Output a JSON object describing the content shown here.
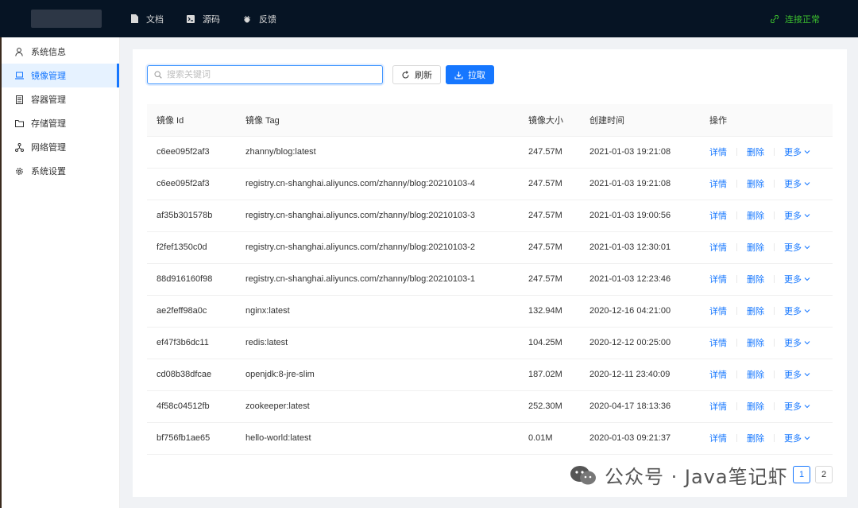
{
  "topbar": {
    "nav": [
      {
        "label": "文档",
        "icon": "document-icon"
      },
      {
        "label": "源码",
        "icon": "code-icon"
      },
      {
        "label": "反馈",
        "icon": "bug-icon"
      }
    ],
    "status": "连接正常"
  },
  "sidebar": {
    "items": [
      {
        "label": "系统信息",
        "icon": "user-icon"
      },
      {
        "label": "镜像管理",
        "icon": "laptop-icon"
      },
      {
        "label": "容器管理",
        "icon": "container-icon"
      },
      {
        "label": "存储管理",
        "icon": "folder-icon"
      },
      {
        "label": "网络管理",
        "icon": "network-icon"
      },
      {
        "label": "系统设置",
        "icon": "gear-icon"
      }
    ]
  },
  "toolbar": {
    "search_placeholder": "搜索关键词",
    "refresh_label": "刷新",
    "pull_label": "拉取"
  },
  "table": {
    "headers": [
      "镜像 Id",
      "镜像 Tag",
      "镜像大小",
      "创建时间",
      "操作"
    ],
    "ops": {
      "detail": "详情",
      "delete": "删除",
      "more": "更多"
    },
    "rows": [
      {
        "id": "c6ee095f2af3",
        "tag": "zhanny/blog:latest",
        "size": "247.57M",
        "created": "2021-01-03 19:21:08"
      },
      {
        "id": "c6ee095f2af3",
        "tag": "registry.cn-shanghai.aliyuncs.com/zhanny/blog:20210103-4",
        "size": "247.57M",
        "created": "2021-01-03 19:21:08"
      },
      {
        "id": "af35b301578b",
        "tag": "registry.cn-shanghai.aliyuncs.com/zhanny/blog:20210103-3",
        "size": "247.57M",
        "created": "2021-01-03 19:00:56"
      },
      {
        "id": "f2fef1350c0d",
        "tag": "registry.cn-shanghai.aliyuncs.com/zhanny/blog:20210103-2",
        "size": "247.57M",
        "created": "2021-01-03 12:30:01"
      },
      {
        "id": "88d916160f98",
        "tag": "registry.cn-shanghai.aliyuncs.com/zhanny/blog:20210103-1",
        "size": "247.57M",
        "created": "2021-01-03 12:23:46"
      },
      {
        "id": "ae2feff98a0c",
        "tag": "nginx:latest",
        "size": "132.94M",
        "created": "2020-12-16 04:21:00"
      },
      {
        "id": "ef47f3b6dc11",
        "tag": "redis:latest",
        "size": "104.25M",
        "created": "2020-12-12 00:25:00"
      },
      {
        "id": "cd08b38dfcae",
        "tag": "openjdk:8-jre-slim",
        "size": "187.02M",
        "created": "2020-12-11 23:40:09"
      },
      {
        "id": "4f58c04512fb",
        "tag": "zookeeper:latest",
        "size": "252.30M",
        "created": "2020-04-17 18:13:36"
      },
      {
        "id": "bf756fb1ae65",
        "tag": "hello-world:latest",
        "size": "0.01M",
        "created": "2020-01-03 09:21:37"
      }
    ]
  },
  "pager": {
    "pages": [
      "1",
      "2"
    ]
  },
  "watermark": "公众号 · Java笔记虾",
  "colors": {
    "primary": "#1677ff",
    "topbar": "#061424",
    "status": "#3cbf2e"
  }
}
